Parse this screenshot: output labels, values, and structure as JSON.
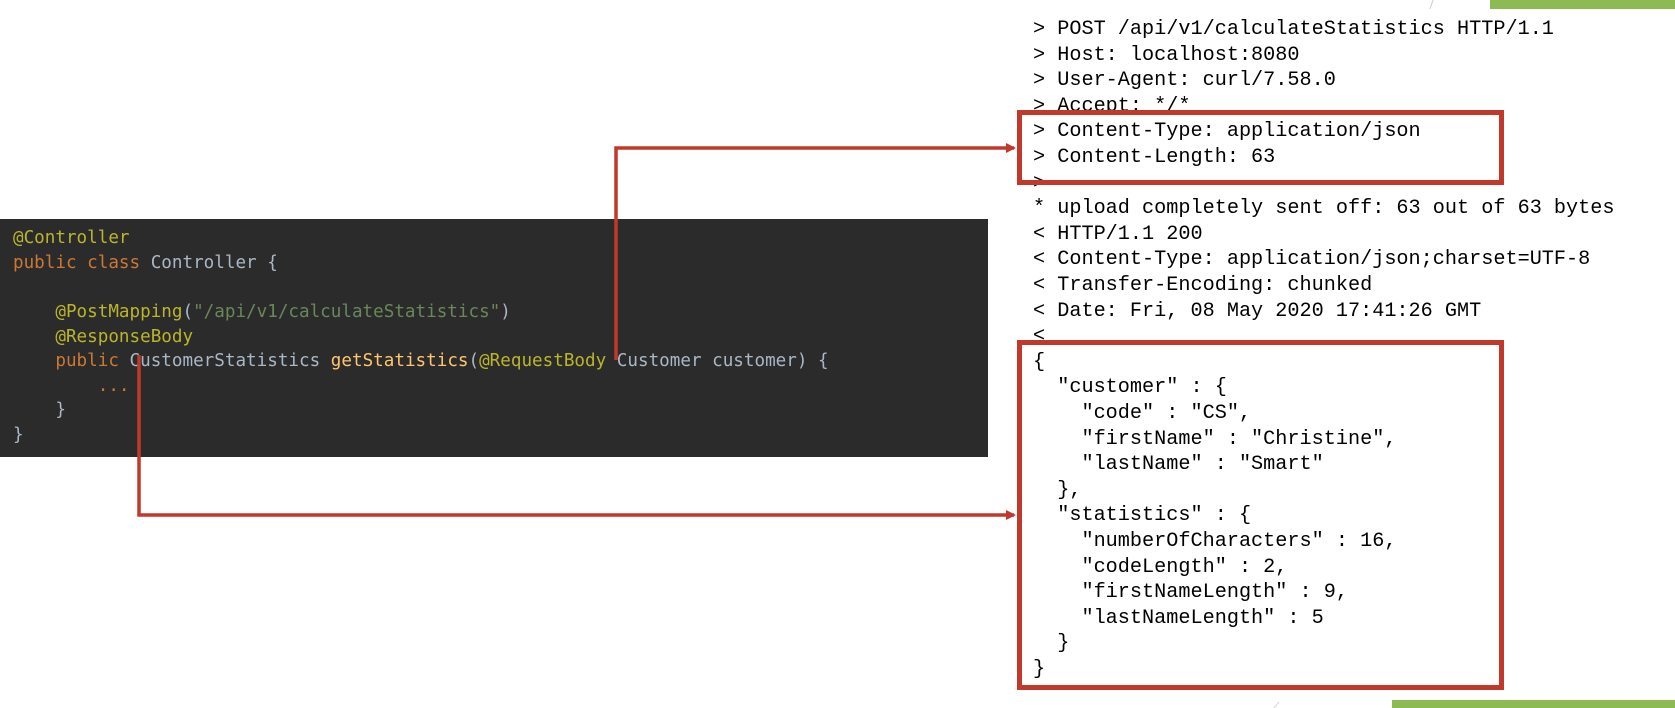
{
  "colors": {
    "accent_red": "#c0392b",
    "deco_green": "#8cba53",
    "code_background": "#2b2b2b",
    "annotation": "#bbb529",
    "keyword": "#cc7832",
    "string": "#6a8759",
    "identifier": "#a9b7c6",
    "method": "#ffc66d"
  },
  "code": {
    "l1_annotation": "@Controller",
    "l2_kw": "public class",
    "l2_name": " Controller {",
    "l4_annotation": "@PostMapping",
    "l4_paren_open": "(",
    "l4_string": "\"/api/v1/calculateStatistics\"",
    "l4_paren_close": ")",
    "l5_annotation": "@ResponseBody",
    "l6_kw": "public",
    "l6_type": " CustomerStatistics ",
    "l6_method": "getStatistics",
    "l6_paren": "(",
    "l6_annotation": "@RequestBody",
    "l6_params": " Customer customer) {",
    "l7_ellipsis": "...",
    "l8_brace": "}",
    "l9_brace": "}"
  },
  "http": {
    "lines": [
      "> POST /api/v1/calculateStatistics HTTP/1.1",
      "> Host: localhost:8080",
      "> User-Agent: curl/7.58.0",
      "> Accept: */*",
      "> Content-Type: application/json",
      "> Content-Length: 63",
      ">",
      "* upload completely sent off: 63 out of 63 bytes",
      "< HTTP/1.1 200",
      "< Content-Type: application/json;charset=UTF-8",
      "< Transfer-Encoding: chunked",
      "< Date: Fri, 08 May 2020 17:41:26 GMT",
      "<",
      "{",
      "  \"customer\" : {",
      "    \"code\" : \"CS\",",
      "    \"firstName\" : \"Christine\",",
      "    \"lastName\" : \"Smart\"",
      "  },",
      "  \"statistics\" : {",
      "    \"numberOfCharacters\" : 16,",
      "    \"codeLength\" : 2,",
      "    \"firstNameLength\" : 9,",
      "    \"lastNameLength\" : 5",
      "  }",
      "}"
    ]
  }
}
